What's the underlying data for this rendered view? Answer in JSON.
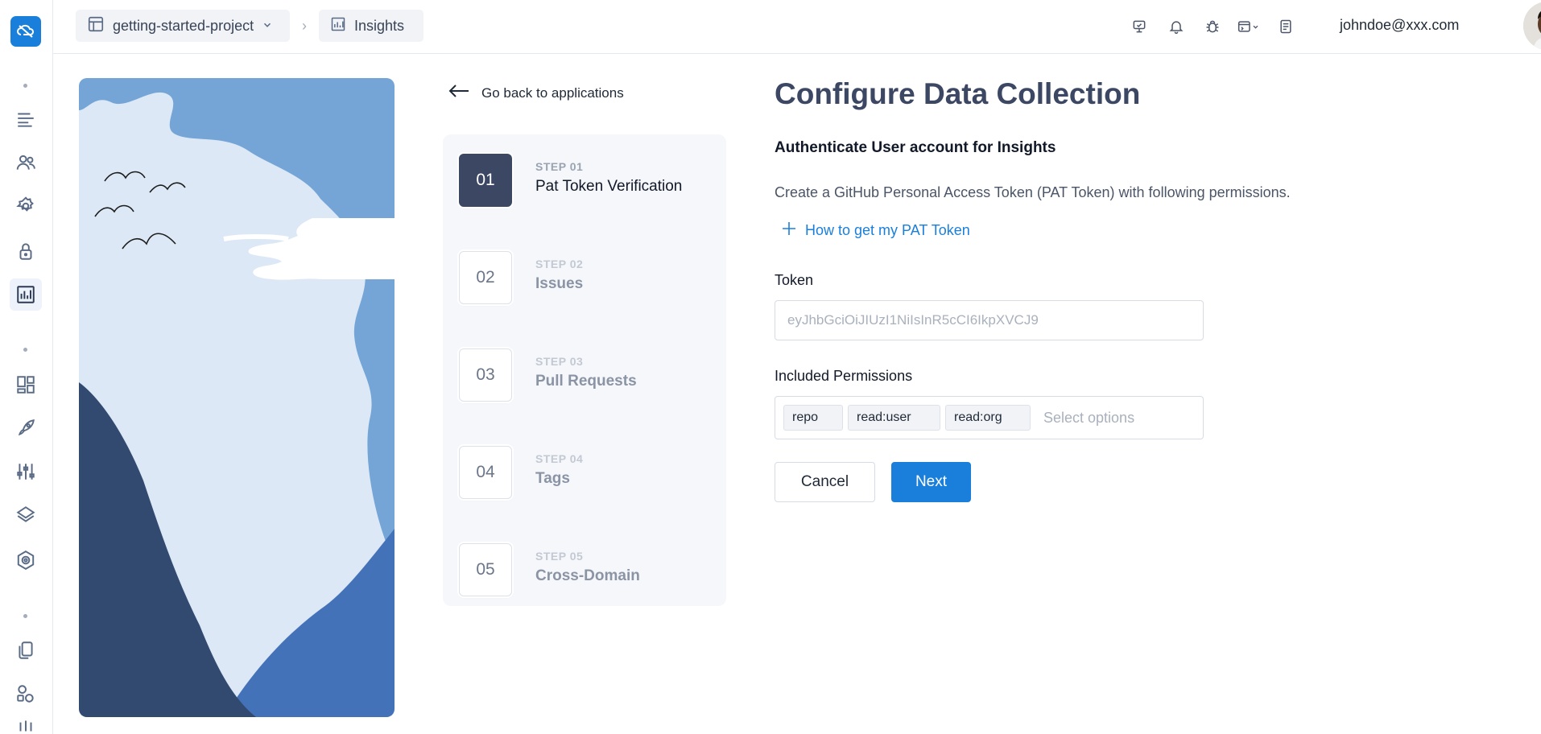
{
  "sidebar": {
    "icons": [
      "cloud-logo-icon",
      "menu-lines-icon",
      "users-icon",
      "gear-icon",
      "lock-icon",
      "bar-chart-icon",
      "grid-blocks-icon",
      "rocket-icon",
      "sliders-icon",
      "layers-icon",
      "webhook-icon",
      "copy-docs-icon",
      "shapes-icon"
    ],
    "active": "bar-chart-icon"
  },
  "header": {
    "project": "getting-started-project",
    "page": "Insights",
    "user_email": "johndoe@xxx.com",
    "icons": [
      "monitor-icon",
      "bell-icon",
      "bug-icon",
      "terminal-dropdown-icon",
      "document-icon"
    ]
  },
  "nav": {
    "back_label": "Go back to applications"
  },
  "steps": [
    {
      "number": "01",
      "label": "STEP 01",
      "title": "Pat Token Verification",
      "active": true
    },
    {
      "number": "02",
      "label": "STEP 02",
      "title": "Issues",
      "active": false
    },
    {
      "number": "03",
      "label": "STEP 03",
      "title": "Pull Requests",
      "active": false
    },
    {
      "number": "04",
      "label": "STEP 04",
      "title": "Tags",
      "active": false
    },
    {
      "number": "05",
      "label": "STEP 05",
      "title": "Cross-Domain",
      "active": false
    }
  ],
  "form": {
    "title": "Configure Data Collection",
    "subtitle": "Authenticate User account for Insights",
    "description": "Create a GitHub Personal Access Token (PAT Token) with following permissions.",
    "howto_link": "How to get my PAT Token",
    "token_label": "Token",
    "token_placeholder": "eyJhbGciOiJIUzI1NiIsInR5cCI6IkpXVCJ9",
    "permissions_label": "Included Permissions",
    "permissions": [
      "repo",
      "read:user",
      "read:org"
    ],
    "permissions_placeholder": "Select options",
    "cancel_label": "Cancel",
    "next_label": "Next"
  },
  "colors": {
    "accent": "#1a7fdb",
    "heading": "#3b4763",
    "step_active_bg": "#3b4763"
  }
}
